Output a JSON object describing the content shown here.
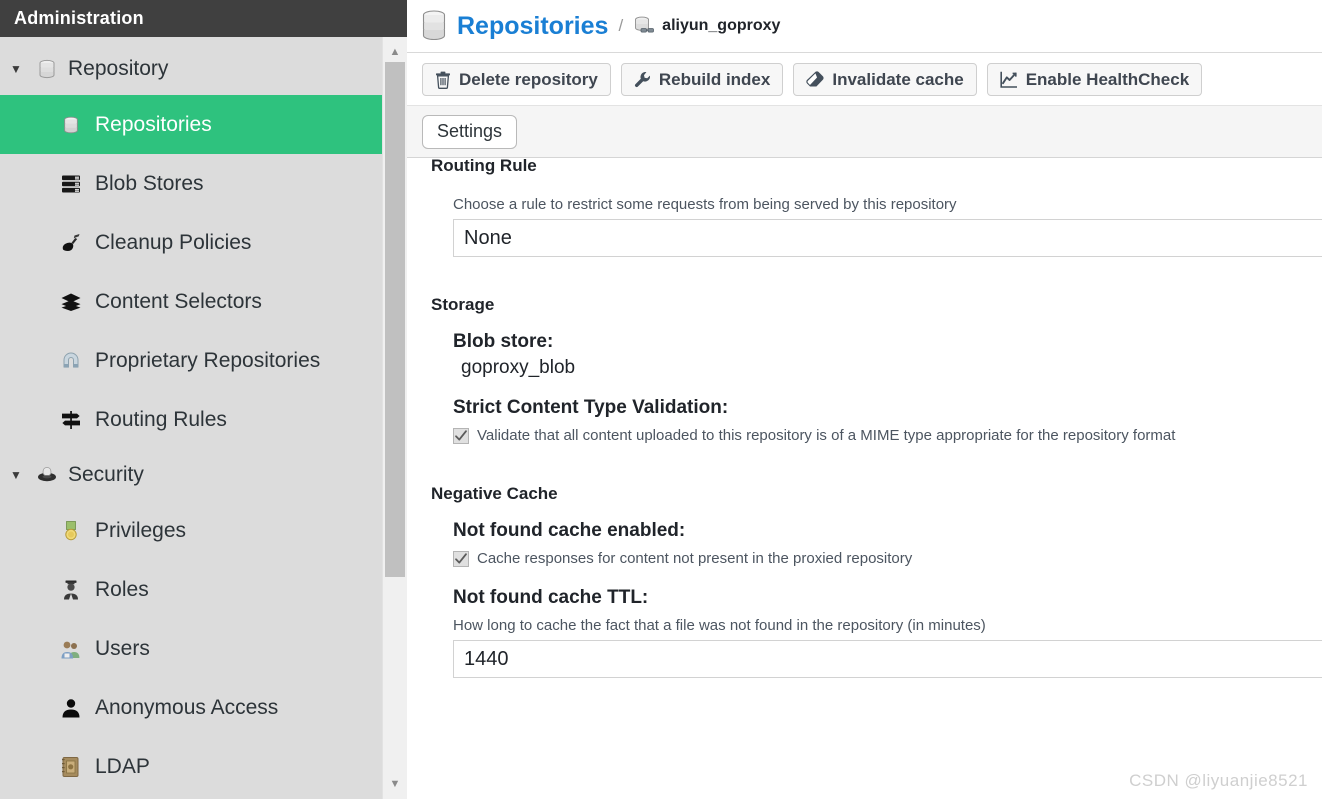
{
  "sidebar": {
    "header_title": "Administration",
    "groups": [
      {
        "label": "Repository",
        "icon": "database-icon",
        "expanded_caret": "▼",
        "items": [
          {
            "label": "Repositories",
            "icon": "database-icon",
            "selected": true
          },
          {
            "label": "Blob Stores",
            "icon": "server-stack-icon",
            "selected": false
          },
          {
            "label": "Cleanup Policies",
            "icon": "broom-icon",
            "selected": false
          },
          {
            "label": "Content Selectors",
            "icon": "layers-icon",
            "selected": false
          },
          {
            "label": "Proprietary Repositories",
            "icon": "magnet-icon",
            "selected": false
          },
          {
            "label": "Routing Rules",
            "icon": "signpost-icon",
            "selected": false
          }
        ]
      },
      {
        "label": "Security",
        "icon": "shield-icon",
        "expanded_caret": "▼",
        "items": [
          {
            "label": "Privileges",
            "icon": "medal-icon",
            "selected": false
          },
          {
            "label": "Roles",
            "icon": "officer-icon",
            "selected": false
          },
          {
            "label": "Users",
            "icon": "users-icon",
            "selected": false
          },
          {
            "label": "Anonymous Access",
            "icon": "person-icon",
            "selected": false
          },
          {
            "label": "LDAP",
            "icon": "address-book-icon",
            "selected": false
          }
        ]
      }
    ],
    "scrollbar": {
      "up_arrow": "▲",
      "down_arrow": "▼"
    }
  },
  "breadcrumb": {
    "root_icon": "database-icon",
    "root_label": "Repositories",
    "separator": "/",
    "leaf_icon": "proxy-repository-icon",
    "leaf_label": "aliyun_goproxy"
  },
  "toolbar": {
    "buttons": [
      {
        "label": "Delete repository",
        "icon": "trash-icon"
      },
      {
        "label": "Rebuild index",
        "icon": "wrench-icon"
      },
      {
        "label": "Invalidate cache",
        "icon": "eraser-icon"
      },
      {
        "label": "Enable HealthCheck",
        "icon": "chart-line-icon"
      }
    ]
  },
  "tabs": [
    {
      "label": "Settings",
      "active": true
    }
  ],
  "form": {
    "routing_rule": {
      "section_title": "Routing Rule",
      "hint": "Choose a rule to restrict some requests from being served by this repository",
      "selected_value": "None"
    },
    "storage": {
      "section_title": "Storage",
      "blob_store_label": "Blob store:",
      "blob_store_value": "goproxy_blob",
      "strict_validation_label": "Strict Content Type Validation:",
      "strict_validation_checkbox_label": "Validate that all content uploaded to this repository is of a MIME type appropriate for the repository format",
      "strict_validation_checked": true
    },
    "negative_cache": {
      "section_title": "Negative Cache",
      "not_found_enabled_label": "Not found cache enabled:",
      "not_found_enabled_checkbox_label": "Cache responses for content not present in the proxied repository",
      "not_found_enabled_checked": true,
      "ttl_label": "Not found cache TTL:",
      "ttl_hint": "How long to cache the fact that a file was not found in the repository (in minutes)",
      "ttl_value": "1440"
    }
  },
  "watermark": "CSDN @liyuanjie8521",
  "colors": {
    "header_bg": "#404040",
    "sidebar_bg": "#dcdcdc",
    "selected_green": "#2ec27e",
    "link_blue": "#1a7fd4",
    "tabbar_bg": "#f5f5f5"
  }
}
